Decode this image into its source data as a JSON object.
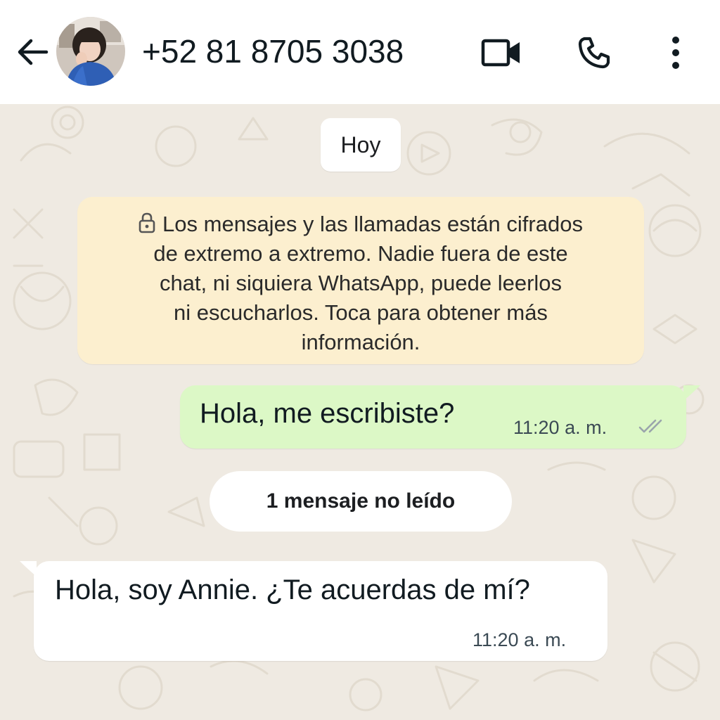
{
  "header": {
    "contact": "+52 81 8705 3038",
    "icons": {
      "back": "arrow-left-icon",
      "video": "video-camera-icon",
      "call": "phone-icon",
      "menu": "more-vertical-icon"
    }
  },
  "chat": {
    "date_label": "Hoy",
    "encryption_notice": {
      "lines": [
        "Los mensajes y las llamadas están cifrados",
        "de extremo a extremo. Nadie fuera de este",
        "chat, ni siquiera WhatsApp, puede leerlos",
        "ni escucharlos. Toca para obtener más",
        "información."
      ],
      "icon": "lock-icon"
    },
    "messages": [
      {
        "direction": "outgoing",
        "text": "Hola, me escribiste?",
        "time": "11:20 a. m.",
        "status": "read"
      },
      {
        "direction": "incoming",
        "text": "Hola, soy Annie. ¿Te acuerdas de mí?",
        "time": "11:20 a. m."
      }
    ],
    "unread_label": "1 mensaje no leído"
  },
  "colors": {
    "chat_background": "#efeae2",
    "outgoing_bubble": "#dcf8c6",
    "incoming_bubble": "#ffffff",
    "notice_bubble": "#fcefcf",
    "read_ticks": "#9aa5ab"
  }
}
